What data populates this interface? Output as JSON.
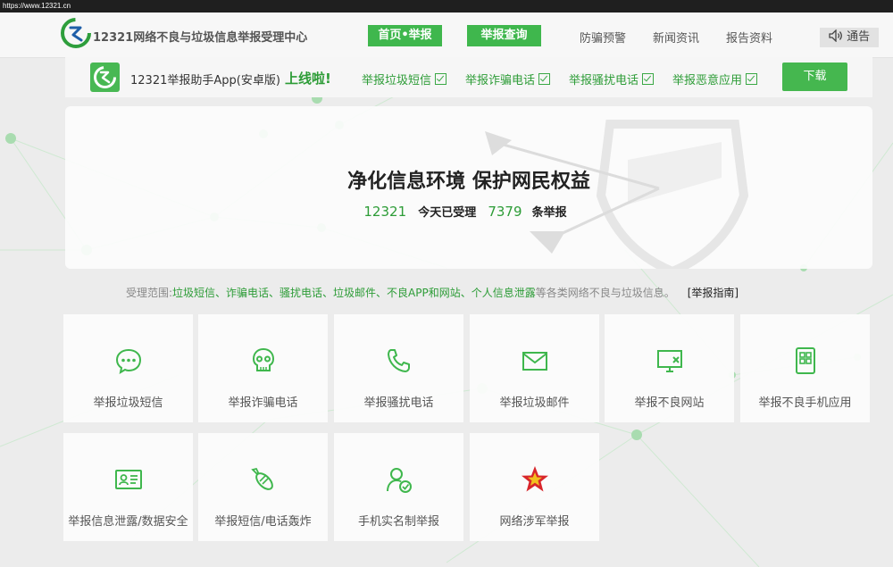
{
  "browser": {
    "url": "https://www.12321.cn"
  },
  "header": {
    "site_title": "12321网络不良与垃圾信息举报受理中心",
    "nav_primary": [
      "首页•举报",
      "举报查询"
    ],
    "nav_links": [
      "防骗预警",
      "新闻资讯",
      "报告资料"
    ],
    "notice_label": "通告"
  },
  "app_banner": {
    "app_name": "12321举报助手App(安卓版)",
    "online_text": "上线啦!",
    "features": [
      "举报垃圾短信",
      "举报诈骗电话",
      "举报骚扰电话",
      "举报恶意应用"
    ],
    "download_label": "下载"
  },
  "hero": {
    "title": "净化信息环境 保护网民权益",
    "hotline": "12321",
    "received_label": "今天已受理",
    "count": "7379",
    "count_suffix": "条举报"
  },
  "scope": {
    "prefix": "受理范围:",
    "items": "垃圾短信、诈骗电话、骚扰电话、垃圾邮件、不良APP和网站、个人信息泄露",
    "suffix": "等各类网络不良与垃圾信息。",
    "guide_label": "[举报指南]"
  },
  "cards": [
    {
      "label": "举报垃圾短信",
      "icon": "sms-icon"
    },
    {
      "label": "举报诈骗电话",
      "icon": "skull-icon"
    },
    {
      "label": "举报骚扰电话",
      "icon": "phone-icon"
    },
    {
      "label": "举报垃圾邮件",
      "icon": "mail-icon"
    },
    {
      "label": "举报不良网站",
      "icon": "monitor-icon"
    },
    {
      "label": "举报不良手机应用",
      "icon": "app-grid-icon"
    },
    {
      "label": "举报信息泄露/数据安全",
      "icon": "id-card-icon"
    },
    {
      "label": "举报短信/电话轰炸",
      "icon": "bomb-icon"
    },
    {
      "label": "手机实名制举报",
      "icon": "user-check-icon"
    },
    {
      "label": "网络涉军举报",
      "icon": "army-star-icon"
    }
  ],
  "colors": {
    "accent": "#3fb74d",
    "accent_text": "#2d9c37",
    "background": "#ececec"
  }
}
